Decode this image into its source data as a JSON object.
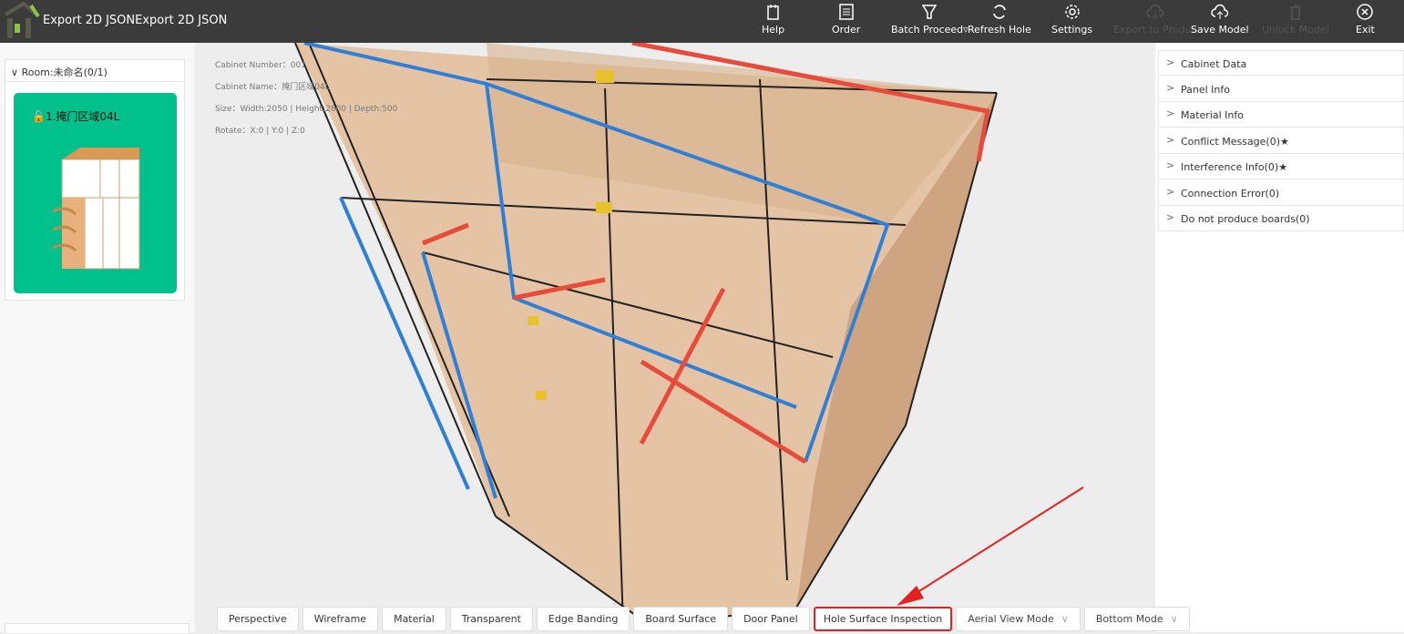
{
  "header": {
    "title": "Export 2D JSONExport 2D JSON",
    "toolbar": [
      {
        "label": "Help",
        "icon": "help-doc-icon",
        "enabled": true
      },
      {
        "label": "Order",
        "icon": "order-list-icon",
        "enabled": true
      },
      {
        "label": "Batch Proceed▿",
        "icon": "filter-icon",
        "enabled": true
      },
      {
        "label": "Refresh Hole",
        "icon": "refresh-icon",
        "enabled": true
      },
      {
        "label": "Settings",
        "icon": "gear-icon",
        "enabled": true
      },
      {
        "label": "Export to Produc",
        "icon": "cloud-download-icon",
        "enabled": false
      },
      {
        "label": "Save Model",
        "icon": "cloud-upload-icon",
        "enabled": true
      },
      {
        "label": "Unlock Model",
        "icon": "trash-icon",
        "enabled": false
      },
      {
        "label": "Exit",
        "icon": "close-circle-icon",
        "enabled": true
      }
    ]
  },
  "sidebar": {
    "room": "Room:未命名(0/1)",
    "cabinet": "1.掩门区域04L"
  },
  "info": {
    "number": "Cabinet Number：001",
    "name": "Cabinet Name：掩门区域04L",
    "size": "Size：Width:2050 | Height:2800 | Depth:500",
    "rotate": "Rotate：X:0 | Y:0 | Z:0"
  },
  "right_panel": [
    "Cabinet Data",
    "Panel Info",
    "Material Info",
    "Conflict Message(0)★",
    "Interference Info(0)★",
    "Connection Error(0)",
    "Do not produce boards(0)"
  ],
  "view_buttons": [
    "Perspective",
    "Wireframe",
    "Material",
    "Transparent",
    "Edge Banding",
    "Board Surface",
    "Door Panel",
    "Hole Surface Inspection"
  ],
  "dropdowns": [
    "Aerial View Mode",
    "Bottom Mode"
  ],
  "colors": {
    "topbar": "#3b3b3b",
    "card": "#00c08b",
    "highlight": "#e52020",
    "edge_blue": "#2f7fd6",
    "edge_red": "#e64b3c",
    "wood": "#e3bc98"
  }
}
